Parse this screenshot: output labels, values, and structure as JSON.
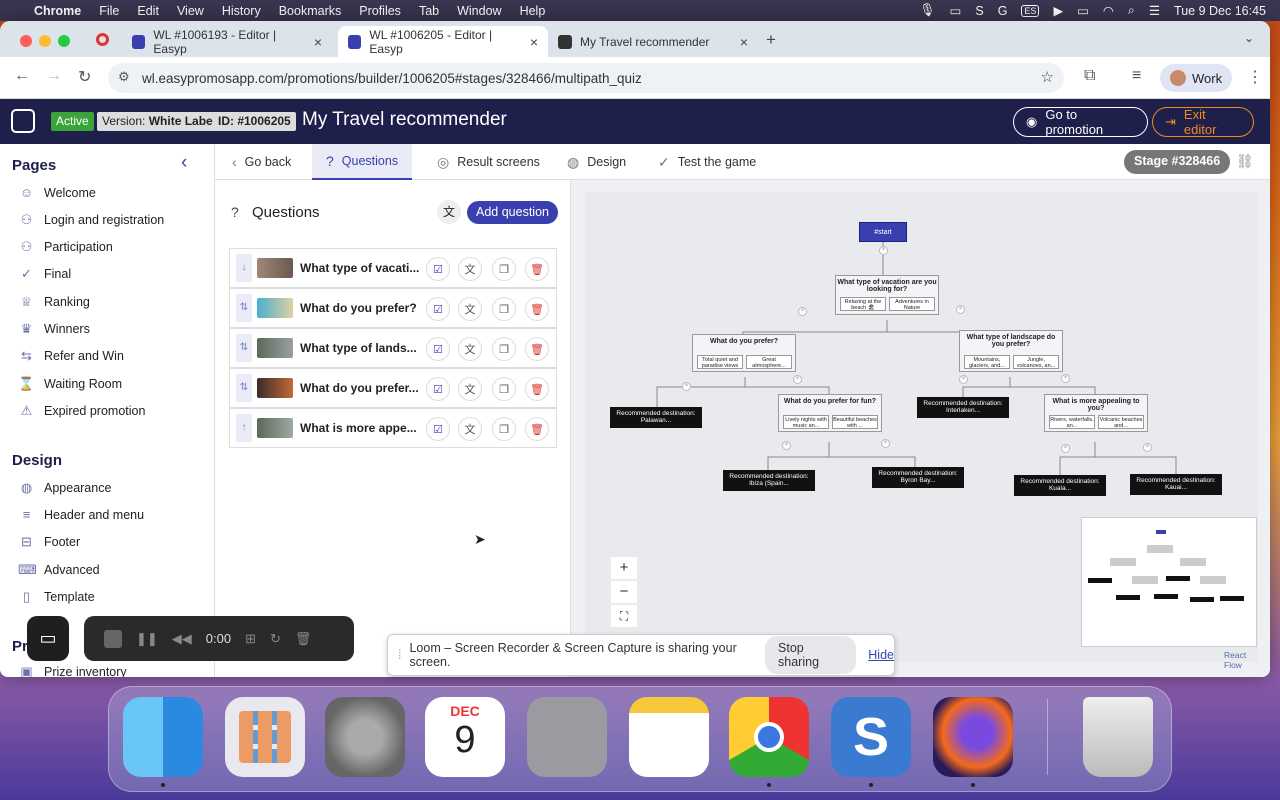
{
  "menubar": {
    "app": "Chrome",
    "items": [
      "File",
      "Edit",
      "View",
      "History",
      "Bookmarks",
      "Profiles",
      "Tab",
      "Window",
      "Help"
    ],
    "input_source": "ES",
    "datetime": "Tue 9 Dec  16:45"
  },
  "tabs": [
    {
      "title": "WL #1006193 - Editor | Easyp"
    },
    {
      "title": "WL #1006205 - Editor | Easyp"
    },
    {
      "title": "My Travel recommender"
    }
  ],
  "address": {
    "url": "wl.easypromosapp.com/promotions/builder/1006205#stages/328466/multipath_quiz",
    "profile": "Work"
  },
  "header": {
    "status": "Active",
    "version_label": "Version:",
    "version": "White Label",
    "id": "ID: #1006205",
    "title": "My Travel recommender",
    "go_to_promotion": "Go to promotion",
    "exit_editor": "Exit editor"
  },
  "sidebar": {
    "pages_title": "Pages",
    "pages": [
      "Welcome",
      "Login and registration",
      "Participation",
      "Final",
      "Ranking",
      "Winners",
      "Refer and Win",
      "Waiting Room",
      "Expired promotion"
    ],
    "design_title": "Design",
    "design": [
      "Appearance",
      "Header and menu",
      "Footer",
      "Advanced",
      "Template"
    ],
    "prizes_title": "Pr",
    "prize_item": "Prize inventory"
  },
  "toolbar": {
    "go_back": "Go back",
    "questions": "Questions",
    "result_screens": "Result screens",
    "design": "Design",
    "test": "Test the game",
    "stage": "Stage #328466"
  },
  "questions": {
    "title": "Questions",
    "add": "Add question",
    "items": [
      "What type of vacati...",
      "What do you prefer?",
      "What type of lands...",
      "What do you prefer...",
      "What is more appe..."
    ]
  },
  "flow": {
    "start": "#start",
    "q1": {
      "title": "What type of vacation are you looking for?",
      "o1": "Relaxing at the beach 🏖",
      "o2": "Adventures in Nature"
    },
    "q2": {
      "title": "What do you prefer?",
      "o1": "Total quiet and paradise views",
      "o2": "Great atmosphere..."
    },
    "q3": {
      "title": "What type of landscape do you prefer?",
      "o1": "Mountains, glaciers, and...",
      "o2": "Jungle, volcanoes, an..."
    },
    "q4": {
      "title": "What do you prefer for fun?",
      "o1": "Lively nights with music an...",
      "o2": "Beautiful beaches with ..."
    },
    "q5": {
      "title": "What is more appealing to you?",
      "o1": "Rivers, waterfalls, an...",
      "o2": "Volcanic beaches and..."
    },
    "r_palawan": "Recommended destination: Palawan...",
    "r_interlaken": "Recommended destination: Interlaken...",
    "r_ibiza": "Recommended destination: Ibiza (Spain...",
    "r_byron": "Recommended destination: Byron Bay...",
    "r_kuala": "Recommended destination: Kuala...",
    "r_kauai": "Recommended destination: Kauai...",
    "attribution": "React Flow"
  },
  "loom": {
    "time": "0:00",
    "message": "Loom – Screen Recorder & Screen Capture is sharing your screen.",
    "stop": "Stop sharing",
    "hide": "Hide"
  },
  "dock": {
    "calendar_month": "DEC",
    "calendar_day": "9"
  }
}
